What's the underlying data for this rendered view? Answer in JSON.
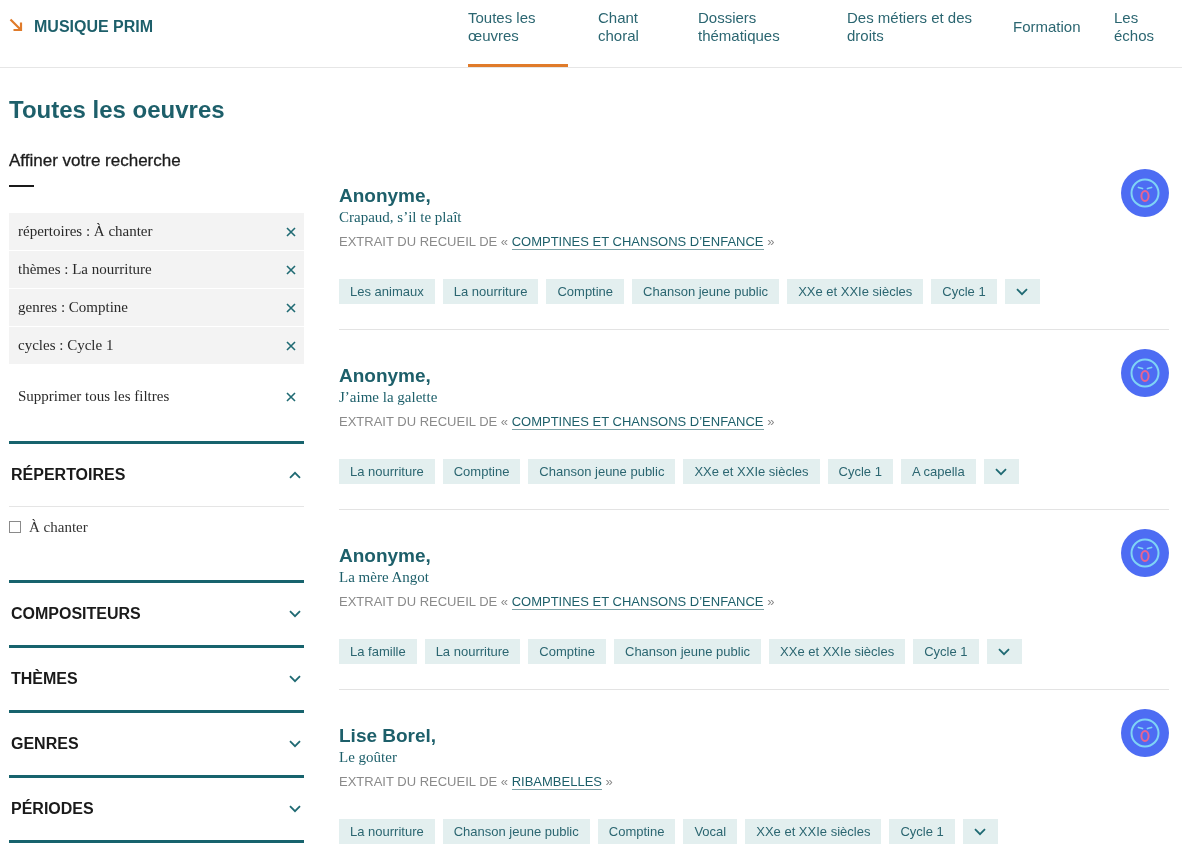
{
  "header": {
    "logo": "MUSIQUE PRIM",
    "nav": [
      {
        "label": "Toutes les œuvres",
        "selected": true
      },
      {
        "label": "Chant choral",
        "selected": false
      },
      {
        "label": "Dossiers thématiques",
        "selected": false
      },
      {
        "label": "Des métiers et des droits",
        "selected": false
      },
      {
        "label": "Formation",
        "selected": false
      },
      {
        "label": "Les échos",
        "selected": false
      }
    ]
  },
  "page_title": "Toutes les oeuvres",
  "sidebar": {
    "heading": "Affiner votre recherche",
    "active_filters": [
      "répertoires : À chanter",
      "thèmes : La nourriture",
      "genres : Comptine",
      "cycles : Cycle 1"
    ],
    "clear_all": "Supprimer tous les filtres",
    "sections": [
      {
        "title": "RÉPERTOIRES",
        "expanded": true,
        "options": [
          {
            "label": "À chanter",
            "checked": false
          }
        ]
      },
      {
        "title": "COMPOSITEURS",
        "expanded": false
      },
      {
        "title": "THÈMES",
        "expanded": false
      },
      {
        "title": "GENRES",
        "expanded": false
      },
      {
        "title": "PÉRIODES",
        "expanded": false
      }
    ]
  },
  "results": [
    {
      "author": "Anonyme,",
      "title": "Crapaud, s’il te plaît",
      "source_prefix": "EXTRAIT DU RECUEIL DE «",
      "collection": "COMPTINES ET CHANSONS D’ENFANCE",
      "source_suffix": "»",
      "tags": [
        "Les animaux",
        "La nourriture",
        "Comptine",
        "Chanson jeune public",
        "XXe et XXIe siècles",
        "Cycle 1"
      ]
    },
    {
      "author": "Anonyme,",
      "title": "J’aime la galette",
      "source_prefix": "EXTRAIT DU RECUEIL DE «",
      "collection": "COMPTINES ET CHANSONS D’ENFANCE",
      "source_suffix": "»",
      "tags": [
        "La nourriture",
        "Comptine",
        "Chanson jeune public",
        "XXe et XXIe siècles",
        "Cycle 1",
        "A capella"
      ]
    },
    {
      "author": "Anonyme,",
      "title": "La mère Angot",
      "source_prefix": "EXTRAIT DU RECUEIL DE «",
      "collection": "COMPTINES ET CHANSONS D’ENFANCE",
      "source_suffix": "»",
      "tags": [
        "La famille",
        "La nourriture",
        "Comptine",
        "Chanson jeune public",
        "XXe et XXIe siècles",
        "Cycle 1"
      ]
    },
    {
      "author": "Lise Borel,",
      "title": "Le goûter",
      "source_prefix": "EXTRAIT DU RECUEIL DE «",
      "collection": "RIBAMBELLES",
      "source_suffix": "»",
      "tags": [
        "La nourriture",
        "Chanson jeune public",
        "Comptine",
        "Vocal",
        "XXe et XXIe siècles",
        "Cycle 1"
      ]
    }
  ]
}
